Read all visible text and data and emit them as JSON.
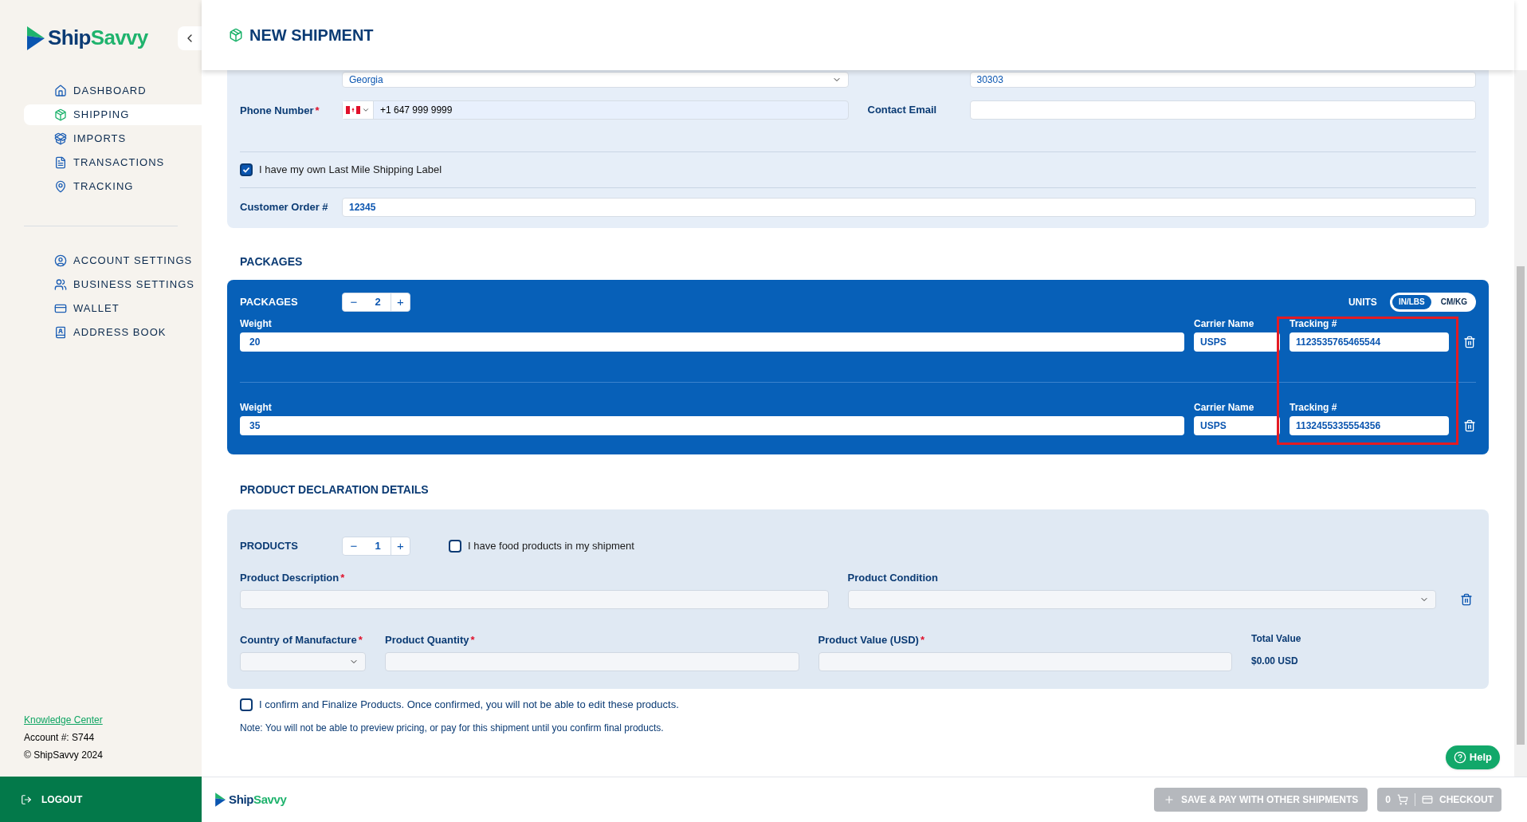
{
  "sidebar": {
    "brand": [
      "Ship",
      "Savvy"
    ],
    "nav": [
      {
        "label": "DASHBOARD",
        "selected": false
      },
      {
        "label": "SHIPPING",
        "selected": true
      },
      {
        "label": "IMPORTS",
        "selected": false
      },
      {
        "label": "TRANSACTIONS",
        "selected": false
      },
      {
        "label": "TRACKING",
        "selected": false
      }
    ],
    "settings": [
      {
        "label": "ACCOUNT SETTINGS",
        "selected": false
      },
      {
        "label": "BUSINESS SETTINGS",
        "selected": false
      },
      {
        "label": "WALLET",
        "selected": false
      },
      {
        "label": "ADDRESS BOOK",
        "selected": false
      }
    ],
    "knowledge_link": "Knowledge Center",
    "account": "Account #: S744",
    "copyright": "© ShipSavvy 2024",
    "logout": "LOGOUT"
  },
  "header": {
    "title": "NEW SHIPMENT"
  },
  "address": {
    "province_value": "Georgia",
    "postal_value": "30303",
    "phone": {
      "label": "Phone Number",
      "mark": "*",
      "value": "+1 647 999 9999"
    },
    "email": {
      "label": "Contact Email"
    },
    "last_mile": {
      "label": "I have my own Last Mile Shipping Label",
      "checked": true
    },
    "order": {
      "label": "Customer Order #",
      "value": "12345"
    }
  },
  "packages": {
    "heading": "PACKAGES",
    "label": "PACKAGES",
    "minus": "−",
    "count": "2",
    "plus": "+",
    "units_label": "UNITS",
    "units": [
      {
        "label": "IN/LBS",
        "selected": true
      },
      {
        "label": "CM/KG",
        "selected": false
      }
    ],
    "rows": [
      {
        "weight_label": "Weight",
        "weight": "20",
        "carrier_label": "Carrier Name",
        "carrier": "USPS",
        "tracking_label": "Tracking #",
        "tracking": "1123535765465544"
      },
      {
        "weight_label": "Weight",
        "weight": "35",
        "carrier_label": "Carrier Name",
        "carrier": "USPS",
        "tracking_label": "Tracking #",
        "tracking": "1132455335554356"
      }
    ]
  },
  "products": {
    "heading": "PRODUCT DECLARATION DETAILS",
    "label": "PRODUCTS",
    "minus": "−",
    "count": "1",
    "plus": "+",
    "food": {
      "label": "I have food products in my shipment",
      "checked": false
    },
    "description": {
      "label": "Product Description",
      "mark": "*"
    },
    "condition": {
      "label": "Product Condition"
    },
    "country": {
      "label": "Country of Manufacture",
      "mark": "*"
    },
    "quantity": {
      "label": "Product Quantity",
      "mark": "*"
    },
    "value": {
      "label": "Product Value (USD)",
      "mark": "*"
    },
    "total_label": "Total Value",
    "total": "$0.00 USD"
  },
  "confirm": {
    "label": "I confirm and Finalize Products. Once confirmed, you will not be able to edit these products.",
    "checked": false
  },
  "note": "Note: You will not be able to preview pricing, or pay for this shipment until you confirm final products.",
  "help": "Help",
  "footer": {
    "brand": [
      "Ship",
      "Savvy"
    ],
    "save": "SAVE & PAY WITH OTHER SHIPMENTS",
    "cart_count": "0",
    "checkout": "CHECKOUT"
  }
}
